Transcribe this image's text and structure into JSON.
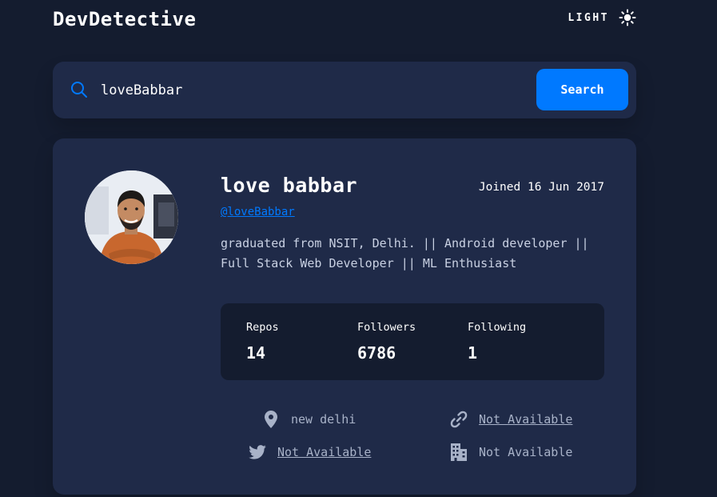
{
  "header": {
    "brand": "DevDetective",
    "theme_label": "LIGHT",
    "theme_icon": "sun-icon"
  },
  "search": {
    "value": "loveBabbar",
    "button_label": "Search",
    "icon": "search-icon"
  },
  "profile": {
    "name": "love babbar",
    "joined": "Joined 16 Jun 2017",
    "username": "@loveBabbar",
    "bio_line1": "graduated from NSIT, Delhi. || Android developer ||",
    "bio_line2": "Full Stack Web Developer || ML Enthusiast",
    "stats": [
      {
        "label": "Repos",
        "value": "14"
      },
      {
        "label": "Followers",
        "value": "6786"
      },
      {
        "label": "Following",
        "value": "1"
      }
    ],
    "info": {
      "location": {
        "icon": "location-pin-icon",
        "text": "new delhi"
      },
      "website": {
        "icon": "link-icon",
        "text": "Not Available"
      },
      "twitter": {
        "icon": "twitter-icon",
        "text": "Not Available"
      },
      "company": {
        "icon": "building-icon",
        "text": "Not Available"
      }
    }
  },
  "colors": {
    "background": "#141c2f",
    "card": "#1f2a48",
    "accent": "#0079ff",
    "muted_text": "#a8b2c8"
  }
}
